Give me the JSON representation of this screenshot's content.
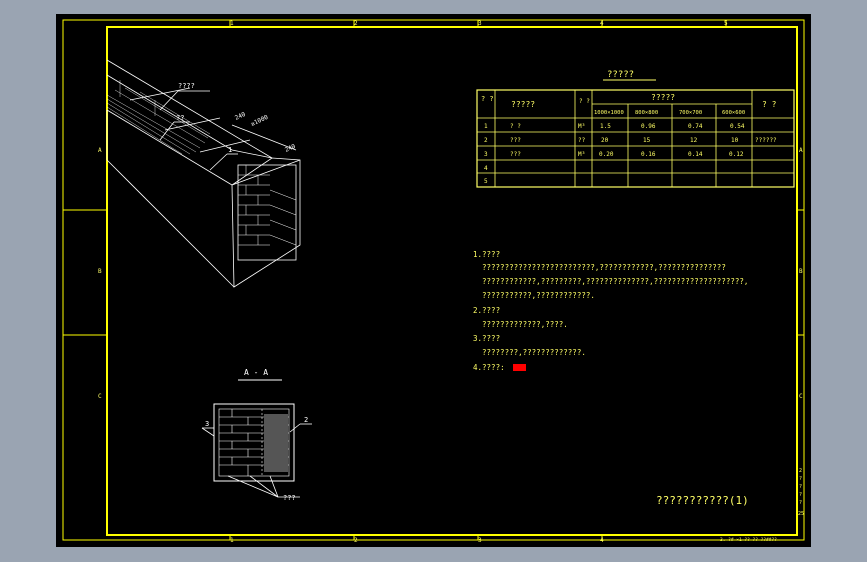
{
  "colors": {
    "background_outer": "#9aa4b2",
    "sheet": "#000000",
    "frame": "#ffff00",
    "linework": "#ffffff",
    "text": "#ffff66",
    "marker": "#ff0000"
  },
  "frame": {
    "column_numbers": [
      "1",
      "2",
      "3",
      "4",
      "5"
    ],
    "row_letters": [
      "A",
      "B",
      "C"
    ],
    "bottom_right_note": "3. ?# ×1 ?? ?? ??##??",
    "side_marks": [
      "2",
      "?",
      "?",
      "?",
      "?",
      "25"
    ]
  },
  "iso_view": {
    "callout_cover": "????",
    "callout_bracket": "??",
    "callout_number": "1",
    "dim_a": "240",
    "dim_b": "≥1000",
    "dim_c": "240"
  },
  "section": {
    "title": "A - A",
    "callout_left": "3",
    "callout_right": "2",
    "callout_bottom": "???"
  },
  "table": {
    "title": "?????",
    "col_header_no": "? ?",
    "col_header_item": "?????",
    "col_header_unit": "? ?",
    "col_header_spec": "?????",
    "col_header_note": "? ?",
    "sizes": [
      "1000×1000",
      "800×800",
      "700×700",
      "600×600"
    ],
    "rows": [
      {
        "no": "1",
        "item": "? ?",
        "unit": "M³",
        "v1": "1.5",
        "v2": "0.96",
        "v3": "0.74",
        "v4": "0.54",
        "note": ""
      },
      {
        "no": "2",
        "item": "???",
        "unit": "??",
        "v1": "20",
        "v2": "15",
        "v3": "12",
        "v4": "10",
        "note": "??????"
      },
      {
        "no": "3",
        "item": "???",
        "unit": "M³",
        "v1": "0.20",
        "v2": "0.16",
        "v3": "0.14",
        "v4": "0.12",
        "note": ""
      },
      {
        "no": "4",
        "item": "",
        "unit": "",
        "v1": "",
        "v2": "",
        "v3": "",
        "v4": "",
        "note": ""
      },
      {
        "no": "5",
        "item": "",
        "unit": "",
        "v1": "",
        "v2": "",
        "v3": "",
        "v4": "",
        "note": ""
      }
    ]
  },
  "notes": {
    "h1": "1.????",
    "l1": "?????????????????????????,????????????,???????????????",
    "l2": "????????????,?????????,??????????????,????????????????????,",
    "l3": "???????????,????????????.",
    "h2": "2.????",
    "l4": "?????????????,????.",
    "h3": "3.????",
    "l5": "????????,?????????????.",
    "h4": "4.????:"
  },
  "title_block": {
    "title": "???????????(1)"
  }
}
